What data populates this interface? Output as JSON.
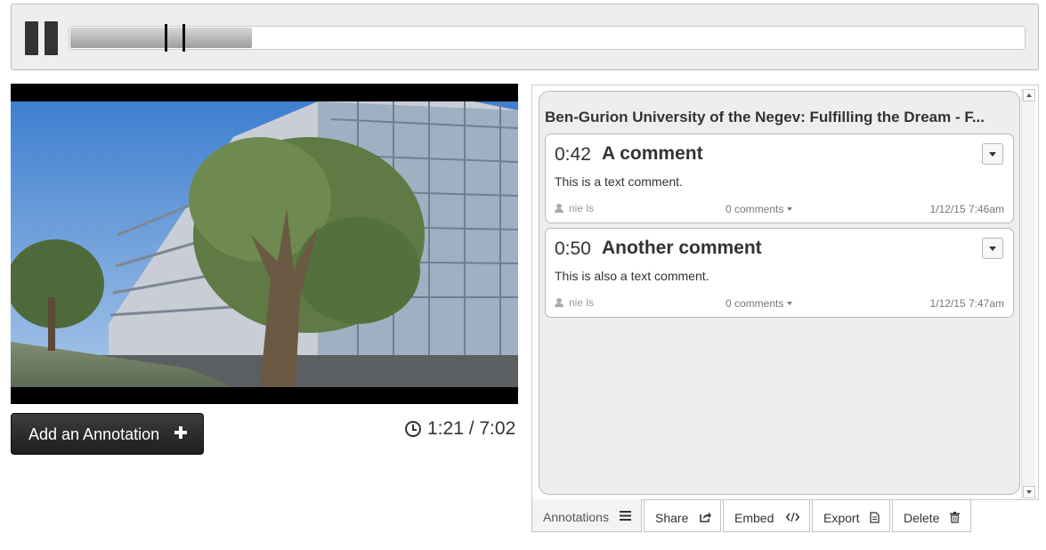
{
  "player": {
    "progress": 0.19,
    "markers": [
      "0:42",
      "0:50"
    ]
  },
  "add_annotation_label": "Add an Annotation",
  "time_display": "1:21 / 7:02",
  "panel": {
    "video_title": "Ben-Gurion University of the Negev: Fulfilling the Dream - F...",
    "annotations": [
      {
        "timestamp": "0:42",
        "title": "A comment",
        "body": "This is a text comment.",
        "user": "nie ls",
        "comments": "0 comments",
        "date": "1/12/15 7:46am"
      },
      {
        "timestamp": "0:50",
        "title": "Another comment",
        "body": "This is also a text comment.",
        "user": "nie ls",
        "comments": "0 comments",
        "date": "1/12/15 7:47am"
      }
    ]
  },
  "tabs": {
    "annotations": "Annotations",
    "share": "Share",
    "embed": "Embed",
    "export": "Export",
    "delete": "Delete"
  },
  "icons": {
    "pause": "pause-icon",
    "plus": "plus-icon",
    "clock": "clock-icon",
    "user": "user-icon",
    "caret": "caret-down-icon",
    "list": "list-icon",
    "share": "share-icon",
    "code": "code-icon",
    "file": "file-icon",
    "trash": "trash-icon"
  }
}
